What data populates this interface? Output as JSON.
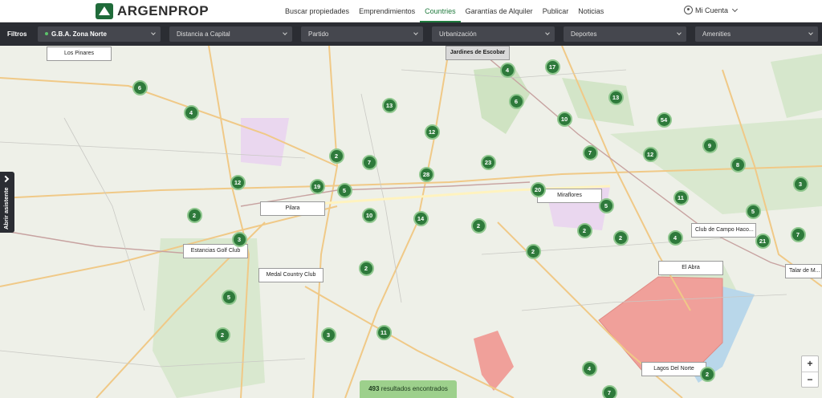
{
  "header": {
    "logo_text": "ARGENPROP",
    "nav": [
      {
        "label": "Buscar propiedades",
        "active": false
      },
      {
        "label": "Emprendimientos",
        "active": false
      },
      {
        "label": "Countries",
        "active": true
      },
      {
        "label": "Garantías de Alquiler",
        "active": false
      },
      {
        "label": "Publicar",
        "active": false
      },
      {
        "label": "Noticias",
        "active": false
      }
    ],
    "account_label": "Mi Cuenta"
  },
  "filters": {
    "label": "Filtros",
    "selects": [
      {
        "value": "G.B.A. Zona Norte"
      },
      {
        "value": "Distancia a Capital"
      },
      {
        "value": "Partido"
      },
      {
        "value": "Urbanización"
      },
      {
        "value": "Deportes"
      },
      {
        "value": "Amenities"
      }
    ]
  },
  "map": {
    "labels": [
      {
        "text": "Los Pinares"
      },
      {
        "text": "Jardines de Escobar"
      },
      {
        "text": "Miraflores"
      },
      {
        "text": "Pilara"
      },
      {
        "text": "Club de Campo Haco..."
      },
      {
        "text": "Estancias Golf Club"
      },
      {
        "text": "El Abra"
      },
      {
        "text": "Talar de M..."
      },
      {
        "text": "Medal Country Club"
      },
      {
        "text": "Lagos Del Norte"
      }
    ],
    "clusters": [
      "6",
      "4",
      "17",
      "4",
      "13",
      "6",
      "13",
      "10",
      "12",
      "54",
      "7",
      "9",
      "12",
      "2",
      "7",
      "8",
      "28",
      "23",
      "3",
      "12",
      "19",
      "5",
      "20",
      "11",
      "2",
      "10",
      "14",
      "5",
      "5",
      "2",
      "2",
      "2",
      "4",
      "21",
      "7",
      "3",
      "2",
      "2",
      "5",
      "3",
      "11",
      "2",
      "4",
      "7"
    ]
  },
  "assistant_label": "Abrir asistente",
  "zoom": {
    "in": "+",
    "out": "−"
  },
  "results": {
    "count": "493",
    "text": "resultados encontrados"
  },
  "colors": {
    "accent": "#1f7a3d",
    "cluster": "#2e7a3b",
    "filterbar": "#2b2d33",
    "results_bar": "#9dd08c",
    "highlight_area": "#f0a09a"
  }
}
